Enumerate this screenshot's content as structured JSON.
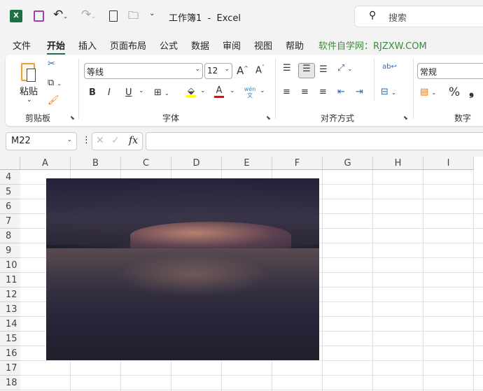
{
  "title": {
    "text": "工作簿1  -  Excel",
    "search_placeholder": "搜索"
  },
  "menu": [
    "文件",
    "开始",
    "插入",
    "页面布局",
    "公式",
    "数据",
    "审阅",
    "视图",
    "帮助",
    "软件自学网：RJZXW.COM"
  ],
  "active_tab": "开始",
  "ribbon": {
    "clipboard": {
      "paste": "粘贴",
      "group": "剪贴板"
    },
    "font": {
      "name": "等线",
      "size": "12",
      "bold": "B",
      "italic": "I",
      "underline": "U",
      "font_color_letter": "A",
      "fill_color": "#ffff00",
      "font_color": "#ff0000",
      "group": "字体",
      "phonetic": "wén 文"
    },
    "alignment": {
      "group": "对齐方式"
    },
    "number": {
      "format": "常规",
      "percent": "%",
      "comma": "❟",
      "group": "数字"
    }
  },
  "formula_bar": {
    "name_box": "M22",
    "value": "",
    "fx": "fx"
  },
  "columns": [
    "A",
    "B",
    "C",
    "D",
    "E",
    "F",
    "G",
    "H",
    "I"
  ],
  "rows": [
    "4",
    "5",
    "6",
    "7",
    "8",
    "9",
    "10",
    "11",
    "12",
    "13",
    "14",
    "15",
    "16",
    "17",
    "18"
  ],
  "colors": {
    "brand_green": "#217346",
    "link_green": "#3a8a3a",
    "save_purple": "#a33ea5"
  }
}
